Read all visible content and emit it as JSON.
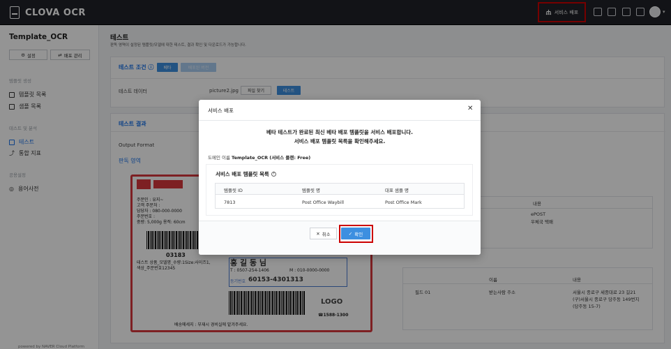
{
  "app": {
    "name": "CLOVA OCR"
  },
  "header": {
    "deploy_label": "서비스 배포"
  },
  "sidebar": {
    "project_name": "Template_OCR",
    "settings_label": "설정",
    "deploy_manage_label": "배포 관리",
    "sections": {
      "template_setup": "템플릿 생성",
      "test_analysis": "테스트 및 분석",
      "general": "공용설정"
    },
    "items": [
      "템플릿 목록",
      "샘플 목록",
      "테스트",
      "통합 지표",
      "용어사전"
    ],
    "footer": "powered by NAVER Cloud Platform"
  },
  "main": {
    "title": "테스트",
    "description": "판독 영역이 설정된 템플릿/모델에 대한 테스트, 결과 확인 및 다운로드가 가능합니다.",
    "test_condition": {
      "title": "테스트 조건",
      "beta": "베타",
      "deploy_version": "배포된 버전"
    },
    "test_data": {
      "label": "테스트 데이터",
      "file": "picture2.jpg",
      "find_file": "파일 찾기",
      "test": "테스트"
    },
    "result": {
      "title": "테스트 결과",
      "output_format": "Output Format",
      "area_title": "판독 영역"
    },
    "right_table": {
      "col_content": "내용",
      "row_value_1": "ePOST",
      "row_value_2": "우체국 택배",
      "col_name": "이름",
      "col_content2": "내용",
      "field": "필드 01",
      "field_name": "받는사람 주소",
      "addr1": "서울시 종로구 세종대로 23 길21",
      "addr2": "(구)서울시 종로구 당주동 149번지",
      "addr3": "(당주동 15-7)"
    },
    "receipt": {
      "name": "홍 길 동 님",
      "tel": "T : 0507-254-1406",
      "mobile": "M : 010-0000-0000",
      "code": "60153-4301313",
      "code_label": "등기번호",
      "logo": "LOGO",
      "footer_note": "배송메세지 : 부재시 경비실에 맡겨주세요.",
      "number": "03183",
      "phone": "☎1588-1300",
      "lines": [
        "주문인 : 유지~",
        "고객 주문처 :",
        "담당자 : 080-000-0000",
        "주문번호 :",
        "중량: 5,000g  용적: 60cm"
      ],
      "item_line": "테스트 상품_모델명_수량:1Size:사이즈1,",
      "order_no": "색상_주문번호12345"
    }
  },
  "modal": {
    "title": "서비스 배포",
    "message_line1": "베타 테스트가 완료된 최신 베타 배포 템플릿을 서비스 배포합니다.",
    "message_line2": "서비스 배포 템플릿 목록을 확인해주세요.",
    "domain_prefix": "도메인 이름",
    "domain_name": "Template_OCR",
    "domain_plan": "(서비스 플랜: Free)",
    "list_title": "서비스 배포 템플릿 목록",
    "table": {
      "headers": [
        "템플릿 ID",
        "템플릿 명",
        "대표 샘플 명"
      ],
      "rows": [
        [
          "7813",
          "Post Office Waybill",
          "Post Office Mark"
        ]
      ]
    },
    "cancel_label": "취소",
    "confirm_label": "확인"
  },
  "colors": {
    "accent": "#1a73e8",
    "highlight": "#cc0000",
    "topbar": "#1f2228"
  }
}
